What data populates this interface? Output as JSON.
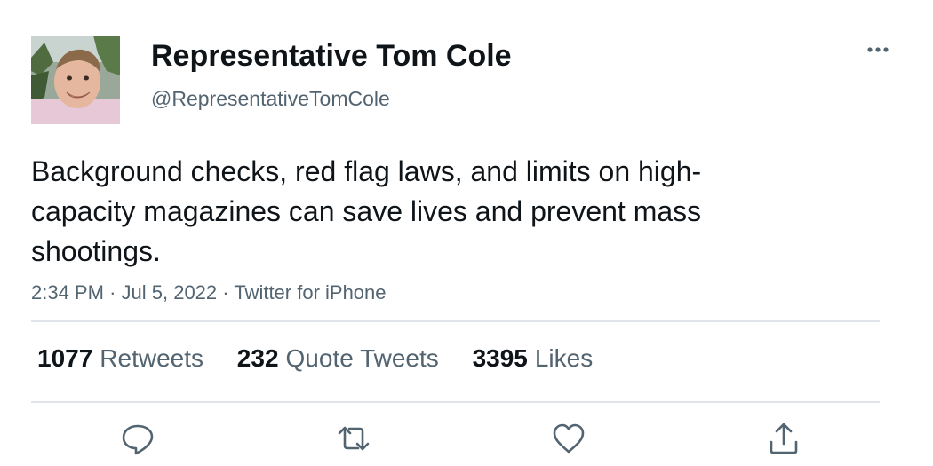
{
  "tweet": {
    "author": {
      "display_name": "Representative Tom Cole",
      "handle": "@RepresentativeTomCole",
      "avatar_icon": "profile-photo"
    },
    "text": "Background checks, red flag laws, and limits on high-\ncapacity magazines can save lives and prevent mass\nshootings.",
    "time": "2:34 PM",
    "date": "Jul 5, 2022",
    "source": "Twitter for iPhone",
    "separator": "·",
    "more_icon": "more-horizontal-icon"
  },
  "stats": {
    "retweets": {
      "count": "1077",
      "label": "Retweets"
    },
    "quotes": {
      "count": "232",
      "label": "Quote Tweets"
    },
    "likes": {
      "count": "3395",
      "label": "Likes"
    }
  },
  "actions": [
    {
      "name": "reply",
      "icon": "reply-icon"
    },
    {
      "name": "retweet",
      "icon": "retweet-icon"
    },
    {
      "name": "like",
      "icon": "heart-icon"
    },
    {
      "name": "share",
      "icon": "share-icon"
    }
  ],
  "colors": {
    "text_primary": "#0f1419",
    "text_secondary": "#536471",
    "divider": "#e1e4e8",
    "background": "#ffffff"
  }
}
